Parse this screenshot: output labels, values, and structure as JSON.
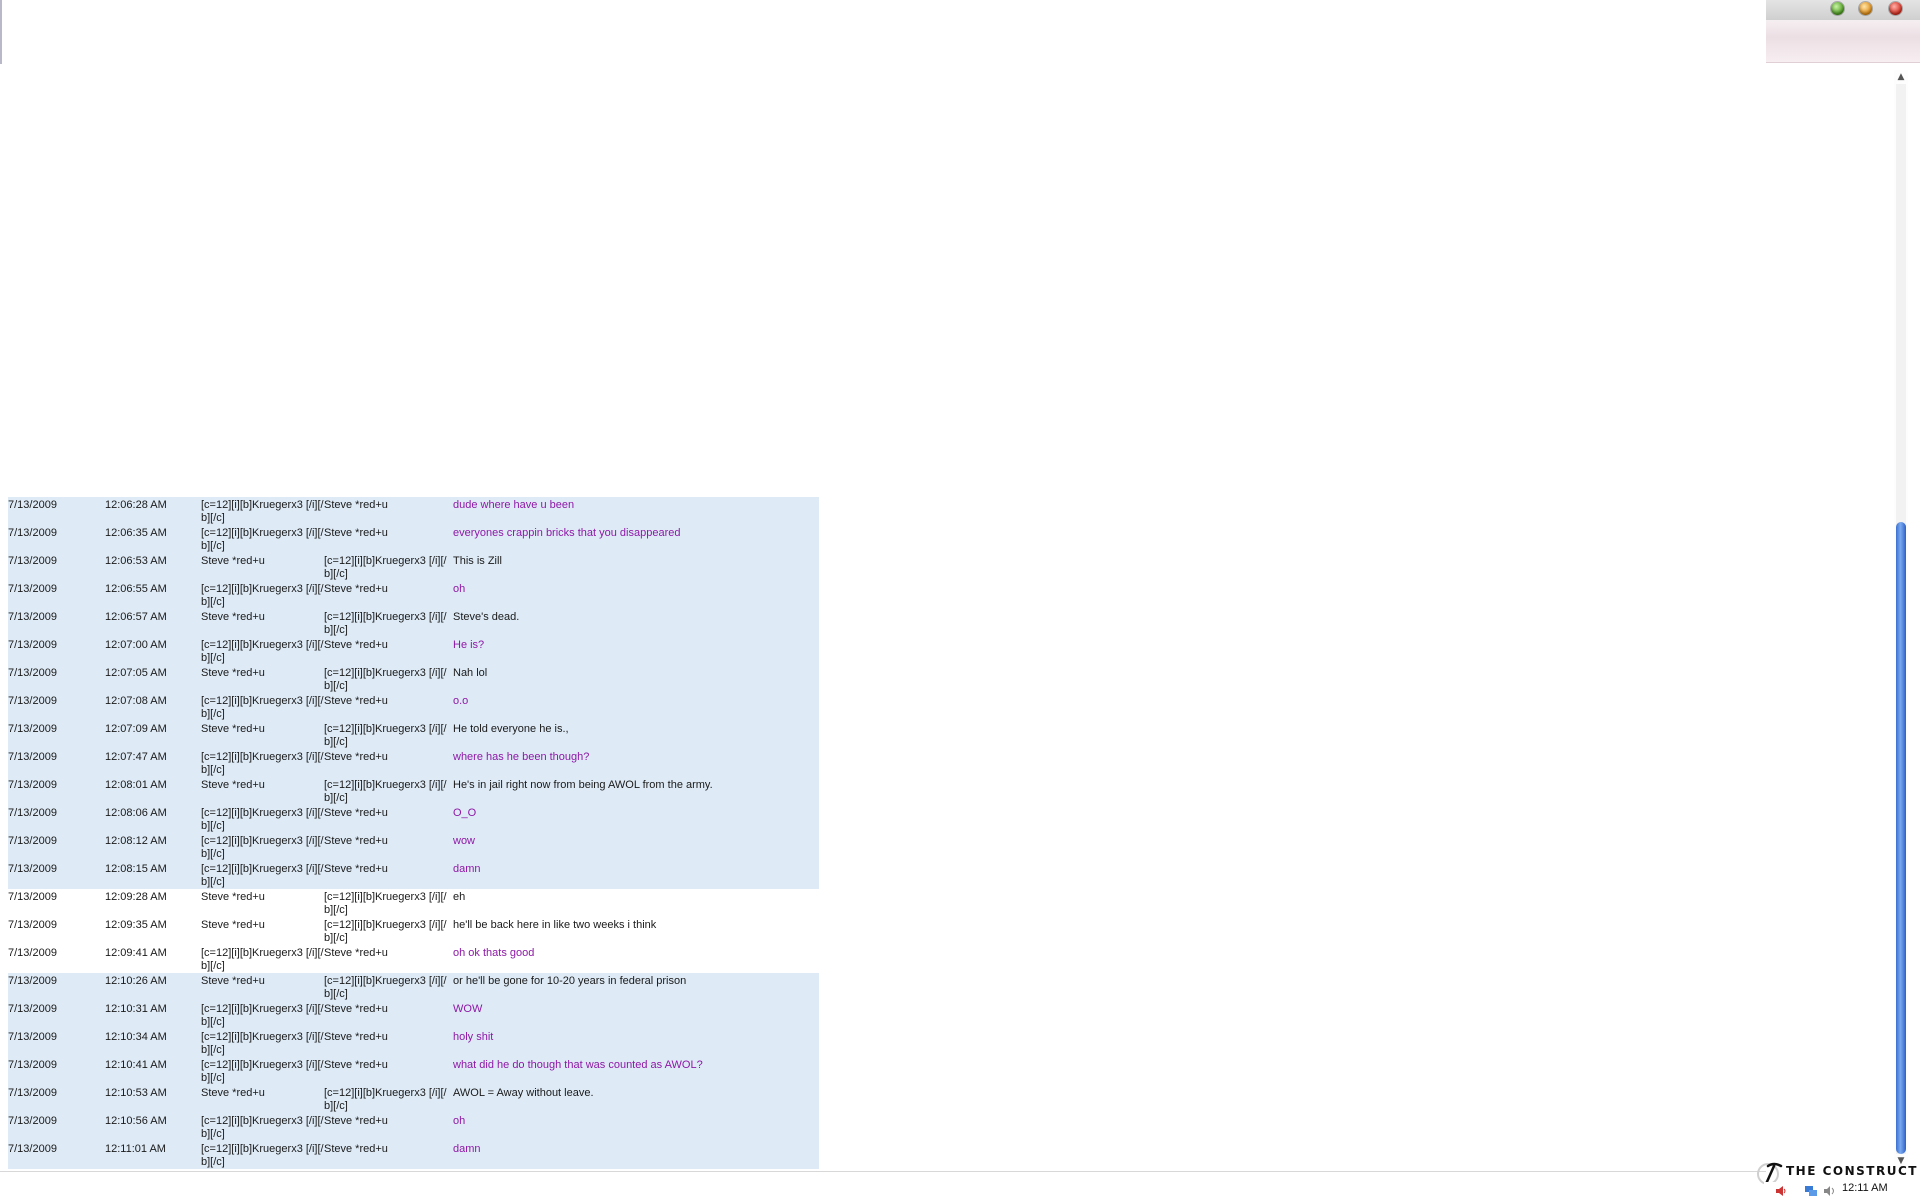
{
  "chat_log": {
    "rows": [
      {
        "date": "7/13/2009",
        "time": "12:06:28 AM",
        "from": "[c=12][i][b]Kruegerx3 [/i][/b][/c]",
        "to": "Steve *red+u",
        "message": "dude where have u been",
        "sender": "them",
        "highlighted": true
      },
      {
        "date": "7/13/2009",
        "time": "12:06:35 AM",
        "from": "[c=12][i][b]Kruegerx3 [/i][/b][/c]",
        "to": "Steve *red+u",
        "message": "everyones crappin bricks that you disappeared",
        "sender": "them",
        "highlighted": true
      },
      {
        "date": "7/13/2009",
        "time": "12:06:53 AM",
        "from": "Steve *red+u",
        "to": "[c=12][i][b]Kruegerx3 [/i][/b][/c]",
        "message": "This is Zill",
        "sender": "me",
        "highlighted": true
      },
      {
        "date": "7/13/2009",
        "time": "12:06:55 AM",
        "from": "[c=12][i][b]Kruegerx3 [/i][/b][/c]",
        "to": "Steve *red+u",
        "message": "oh",
        "sender": "them",
        "highlighted": true
      },
      {
        "date": "7/13/2009",
        "time": "12:06:57 AM",
        "from": "Steve *red+u",
        "to": "[c=12][i][b]Kruegerx3 [/i][/b][/c]",
        "message": "Steve's dead.",
        "sender": "me",
        "highlighted": true
      },
      {
        "date": "7/13/2009",
        "time": "12:07:00 AM",
        "from": "[c=12][i][b]Kruegerx3 [/i][/b][/c]",
        "to": "Steve *red+u",
        "message": "He is?",
        "sender": "them",
        "highlighted": true
      },
      {
        "date": "7/13/2009",
        "time": "12:07:05 AM",
        "from": "Steve *red+u",
        "to": "[c=12][i][b]Kruegerx3 [/i][/b][/c]",
        "message": "Nah lol",
        "sender": "me",
        "highlighted": true
      },
      {
        "date": "7/13/2009",
        "time": "12:07:08 AM",
        "from": "[c=12][i][b]Kruegerx3 [/i][/b][/c]",
        "to": "Steve *red+u",
        "message": "o.o",
        "sender": "them",
        "highlighted": true
      },
      {
        "date": "7/13/2009",
        "time": "12:07:09 AM",
        "from": "Steve *red+u",
        "to": "[c=12][i][b]Kruegerx3 [/i][/b][/c]",
        "message": "He told everyone he is.,",
        "sender": "me",
        "highlighted": true
      },
      {
        "date": "7/13/2009",
        "time": "12:07:47 AM",
        "from": "[c=12][i][b]Kruegerx3 [/i][/b][/c]",
        "to": "Steve *red+u",
        "message": "where has he been though?",
        "sender": "them",
        "highlighted": true
      },
      {
        "date": "7/13/2009",
        "time": "12:08:01 AM",
        "from": "Steve *red+u",
        "to": "[c=12][i][b]Kruegerx3 [/i][/b][/c]",
        "message": "He's in jail right now from being AWOL from the army.",
        "sender": "me",
        "highlighted": true
      },
      {
        "date": "7/13/2009",
        "time": "12:08:06 AM",
        "from": "[c=12][i][b]Kruegerx3 [/i][/b][/c]",
        "to": "Steve *red+u",
        "message": "O_O",
        "sender": "them",
        "highlighted": true
      },
      {
        "date": "7/13/2009",
        "time": "12:08:12 AM",
        "from": "[c=12][i][b]Kruegerx3 [/i][/b][/c]",
        "to": "Steve *red+u",
        "message": "wow",
        "sender": "them",
        "highlighted": true
      },
      {
        "date": "7/13/2009",
        "time": "12:08:15 AM",
        "from": "[c=12][i][b]Kruegerx3 [/i][/b][/c]",
        "to": "Steve *red+u",
        "message": "damn",
        "sender": "them",
        "highlighted": true
      },
      {
        "date": "7/13/2009",
        "time": "12:09:28 AM",
        "from": "Steve *red+u",
        "to": "[c=12][i][b]Kruegerx3 [/i][/b][/c]",
        "message": "eh",
        "sender": "me",
        "highlighted": false
      },
      {
        "date": "7/13/2009",
        "time": "12:09:35 AM",
        "from": "Steve *red+u",
        "to": "[c=12][i][b]Kruegerx3 [/i][/b][/c]",
        "message": "he'll be back here in like two weeks i think",
        "sender": "me",
        "highlighted": false
      },
      {
        "date": "7/13/2009",
        "time": "12:09:41 AM",
        "from": "[c=12][i][b]Kruegerx3 [/i][/b][/c]",
        "to": "Steve *red+u",
        "message": "oh ok thats good",
        "sender": "them",
        "highlighted": false
      },
      {
        "date": "7/13/2009",
        "time": "12:10:26 AM",
        "from": "Steve *red+u",
        "to": "[c=12][i][b]Kruegerx3 [/i][/b][/c]",
        "message": "or he'll be gone for 10-20 years in federal prison",
        "sender": "me",
        "highlighted": true
      },
      {
        "date": "7/13/2009",
        "time": "12:10:31 AM",
        "from": "[c=12][i][b]Kruegerx3 [/i][/b][/c]",
        "to": "Steve *red+u",
        "message": "WOW",
        "sender": "them",
        "highlighted": true
      },
      {
        "date": "7/13/2009",
        "time": "12:10:34 AM",
        "from": "[c=12][i][b]Kruegerx3 [/i][/b][/c]",
        "to": "Steve *red+u",
        "message": "holy shit",
        "sender": "them",
        "highlighted": true
      },
      {
        "date": "7/13/2009",
        "time": "12:10:41 AM",
        "from": "[c=12][i][b]Kruegerx3 [/i][/b][/c]",
        "to": "Steve *red+u",
        "message": "what did he do though that was counted as AWOL?",
        "sender": "them",
        "highlighted": true
      },
      {
        "date": "7/13/2009",
        "time": "12:10:53 AM",
        "from": "Steve *red+u",
        "to": "[c=12][i][b]Kruegerx3 [/i][/b][/c]",
        "message": "AWOL = Away without leave.",
        "sender": "me",
        "highlighted": true
      },
      {
        "date": "7/13/2009",
        "time": "12:10:56 AM",
        "from": "[c=12][i][b]Kruegerx3 [/i][/b][/c]",
        "to": "Steve *red+u",
        "message": "oh",
        "sender": "them",
        "highlighted": true
      },
      {
        "date": "7/13/2009",
        "time": "12:11:01 AM",
        "from": "[c=12][i][b]Kruegerx3 [/i][/b][/c]",
        "to": "Steve *red+u",
        "message": "damn",
        "sender": "them",
        "highlighted": true
      }
    ]
  },
  "colors": {
    "highlight_row": "#deebf7",
    "message_them": "#8e18a6",
    "message_me": "#1a1a1a",
    "scroll_thumb": "#3b6fd0"
  },
  "window_controls": {
    "icons": [
      "maximize-icon",
      "minimize-icon",
      "close-icon"
    ]
  },
  "brand": {
    "text": "THE CONSTRUCT",
    "icon": "pickaxe-logo-icon"
  },
  "tray": {
    "icons": [
      "volume-icon",
      "network-icon",
      "speaker-icon"
    ],
    "clock": "12:11 AM"
  }
}
